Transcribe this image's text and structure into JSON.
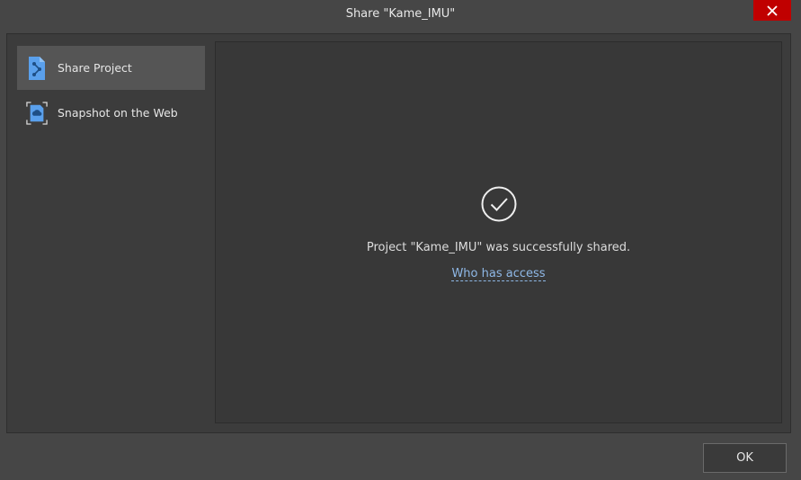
{
  "window": {
    "title": "Share \"Kame_IMU\"",
    "close_icon": "close-icon"
  },
  "sidebar": {
    "items": [
      {
        "label": "Share Project",
        "icon": "share-project-icon",
        "active": true
      },
      {
        "label": "Snapshot on the Web",
        "icon": "cloud-snapshot-icon",
        "active": false
      }
    ]
  },
  "main": {
    "status_icon": "check-circle-icon",
    "message": "Project \"Kame_IMU\" was successfully shared.",
    "access_link": "Who has access"
  },
  "footer": {
    "ok_label": "OK"
  },
  "colors": {
    "close_button": "#c00000",
    "accent_icon": "#5aa0ec",
    "link": "#8fb8e6"
  }
}
